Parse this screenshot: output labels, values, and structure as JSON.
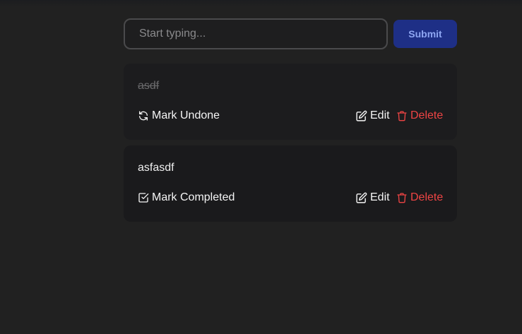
{
  "form": {
    "input_placeholder": "Start typing...",
    "input_value": "",
    "submit_label": "Submit"
  },
  "todos": [
    {
      "text": "asdf",
      "completed": true,
      "toggle_label": "Mark Undone",
      "toggle_icon": "refresh-icon",
      "edit_label": "Edit",
      "delete_label": "Delete"
    },
    {
      "text": "asfasdf",
      "completed": false,
      "toggle_label": "Mark Completed",
      "toggle_icon": "checkbox-icon",
      "edit_label": "Edit",
      "delete_label": "Delete"
    }
  ],
  "colors": {
    "background": "#212121",
    "card": "#1a1a1c",
    "submit_bg": "#1e2f86",
    "submit_text": "#8ea6f2",
    "delete": "#ee4444"
  }
}
